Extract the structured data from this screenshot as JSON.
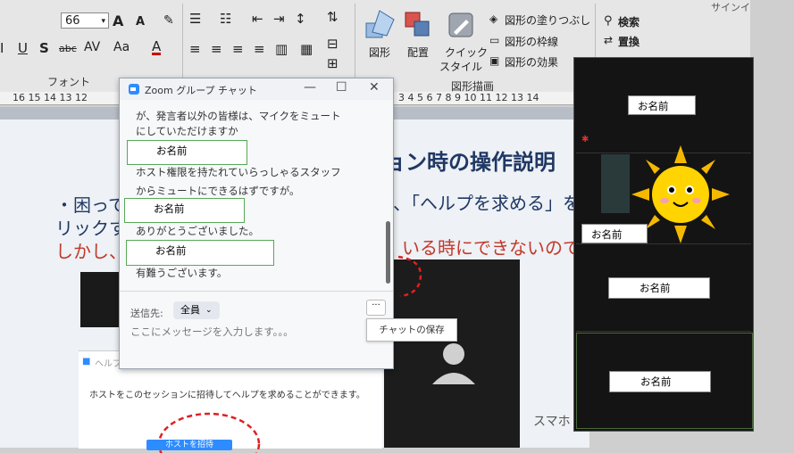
{
  "ribbon": {
    "font_size": "66",
    "grow_font": "A",
    "shrink_font": "A",
    "underline": "U",
    "strike": "S",
    "abc": "abc",
    "av": "AV",
    "aa": "Aa",
    "font_color": "A",
    "font_group_label": "フォント",
    "shape_label": "図形",
    "arrange_label": "配置",
    "quick_style_label_1": "クイック",
    "quick_style_label_2": "スタイル",
    "fill_label": "図形の塗りつぶし",
    "outline_label": "図形の枠線",
    "effect_label": "図形の効果",
    "drawing_group_label": "図形描画",
    "search_label": "検索",
    "replace_label": "置換",
    "top_right_text": "サインイ"
  },
  "ruler": {
    "left_text": "16 15 14 13 12",
    "right_text": "3 4 5 6 7 8 9 10 11 12 13 14"
  },
  "slide": {
    "title": "ョン時の操作説明",
    "line1_left": "・困って",
    "line1_right": "、「ヘルプを求める」を",
    "line2_left": "リックす",
    "line3_left": "しかし、",
    "line3_right": "いる時にできないので注",
    "help_text": "ホストをこのセッションに招待してヘルプを求めることができます。",
    "help_button": "ホストを招待",
    "smartphone": "スマホ"
  },
  "chat": {
    "title": "Zoom グループ チャット",
    "messages": [
      "が、発言者以外の皆様は、マイクをミュート",
      "にしていただけますか",
      "ホスト権限を持たれていらっしゃるスタッフ",
      "からミュートにできるはずですが。",
      "ありがとうございました。",
      "有難うございます。"
    ],
    "names": [
      "お名前",
      "お名前",
      "お名前"
    ],
    "recipient_label": "送信先:",
    "recipient_value": "全員",
    "input_placeholder": "ここにメッセージを入力します。。。",
    "more_label": "···",
    "save_chat": "チャットの保存"
  },
  "gallery": {
    "names": [
      "お名前",
      "お名前",
      "お名前",
      "お名前"
    ]
  }
}
